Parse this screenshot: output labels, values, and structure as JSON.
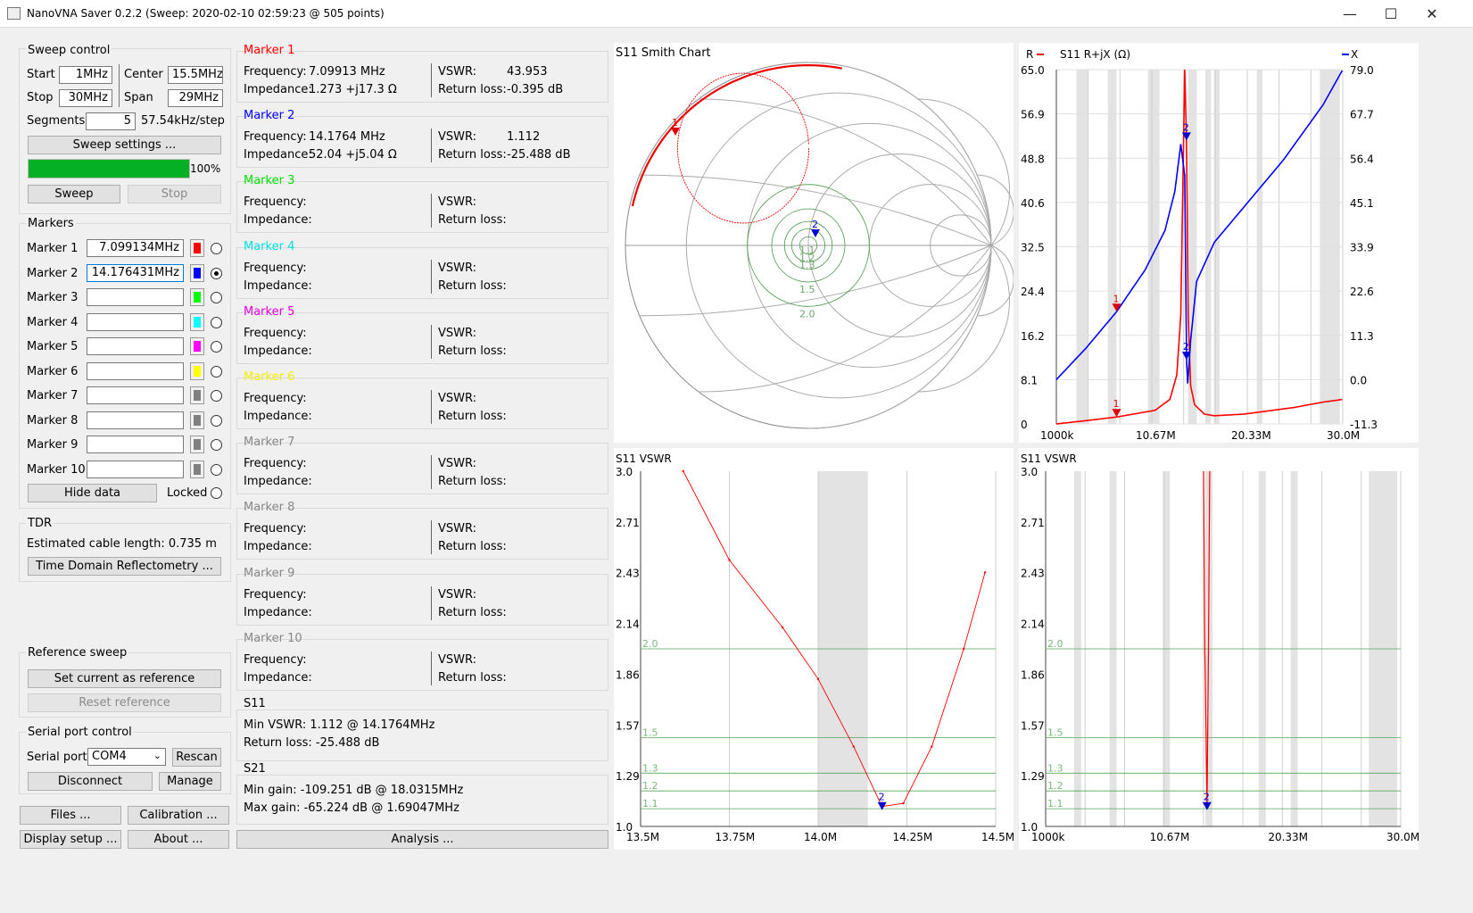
{
  "window": {
    "title": "NanoVNA Saver 0.2.2 (Sweep: 2020-02-10 02:59:23 @ 505 points)"
  },
  "sweep": {
    "title": "Sweep control",
    "start_label": "Start",
    "start": "1MHz",
    "center_label": "Center",
    "center": "15.5MHz",
    "stop_label": "Stop",
    "stop": "30MHz",
    "span_label": "Span",
    "span": "29MHz",
    "segments_label": "Segments",
    "segments": "5",
    "step": "57.54kHz/step",
    "settings_button": "Sweep settings ...",
    "progress": 100,
    "progress_label": "100%",
    "sweep_button": "Sweep",
    "stop_button": "Stop"
  },
  "markers_panel": {
    "title": "Markers",
    "items": [
      {
        "label": "Marker 1",
        "value": "7.099134MHz",
        "color": "#ff0000",
        "selected": false
      },
      {
        "label": "Marker 2",
        "value": "14.176431MHz",
        "color": "#0000ff",
        "selected": true
      },
      {
        "label": "Marker 3",
        "value": "",
        "color": "#00ff00",
        "selected": false
      },
      {
        "label": "Marker 4",
        "value": "",
        "color": "#00ffff",
        "selected": false
      },
      {
        "label": "Marker 5",
        "value": "",
        "color": "#ff00ff",
        "selected": false
      },
      {
        "label": "Marker 6",
        "value": "",
        "color": "#ffff00",
        "selected": false
      },
      {
        "label": "Marker 7",
        "value": "",
        "color": "#808080",
        "selected": false
      },
      {
        "label": "Marker 8",
        "value": "",
        "color": "#808080",
        "selected": false
      },
      {
        "label": "Marker 9",
        "value": "",
        "color": "#808080",
        "selected": false
      },
      {
        "label": "Marker 10",
        "value": "",
        "color": "#808080",
        "selected": false
      }
    ],
    "hide_button": "Hide data",
    "locked_label": "Locked"
  },
  "tdr": {
    "title": "TDR",
    "cable_text": "Estimated cable length: 0.735 m",
    "button": "Time Domain Reflectometry ..."
  },
  "reference": {
    "title": "Reference sweep",
    "set_button": "Set current as reference",
    "reset_button": "Reset reference"
  },
  "serial": {
    "title": "Serial port control",
    "port_label": "Serial port",
    "port_value": "COM4",
    "rescan_button": "Rescan",
    "disconnect_button": "Disconnect",
    "manage_button": "Manage"
  },
  "bottom_buttons": {
    "files": "Files ...",
    "calibration": "Calibration ...",
    "display": "Display setup ...",
    "about": "About ...",
    "analysis": "Analysis ..."
  },
  "marker_details": {
    "freq_label": "Frequency:",
    "imp_label": "Impedance:",
    "vswr_label": "VSWR:",
    "rl_label": "Return loss:",
    "items": [
      {
        "title": "Marker 1",
        "color": "#ff0000",
        "frequency": "7.09913 MHz",
        "impedance": "1.273 +j17.3 Ω",
        "vswr": "43.953",
        "return_loss": "-0.395 dB"
      },
      {
        "title": "Marker 2",
        "color": "#0000ff",
        "frequency": "14.1764 MHz",
        "impedance": "52.04 +j5.04 Ω",
        "vswr": "1.112",
        "return_loss": "-25.488 dB"
      },
      {
        "title": "Marker 3",
        "color": "#00e000",
        "frequency": "",
        "impedance": "",
        "vswr": "",
        "return_loss": ""
      },
      {
        "title": "Marker 4",
        "color": "#00e0e0",
        "frequency": "",
        "impedance": "",
        "vswr": "",
        "return_loss": ""
      },
      {
        "title": "Marker 5",
        "color": "#e000e0",
        "frequency": "",
        "impedance": "",
        "vswr": "",
        "return_loss": ""
      },
      {
        "title": "Marker 6",
        "color": "#f0f000",
        "frequency": "",
        "impedance": "",
        "vswr": "",
        "return_loss": ""
      },
      {
        "title": "Marker 7",
        "color": "#888888",
        "frequency": "",
        "impedance": "",
        "vswr": "",
        "return_loss": ""
      },
      {
        "title": "Marker 8",
        "color": "#888888",
        "frequency": "",
        "impedance": "",
        "vswr": "",
        "return_loss": ""
      },
      {
        "title": "Marker 9",
        "color": "#888888",
        "frequency": "",
        "impedance": "",
        "vswr": "",
        "return_loss": ""
      },
      {
        "title": "Marker 10",
        "color": "#888888",
        "frequency": "",
        "impedance": "",
        "vswr": "",
        "return_loss": ""
      }
    ]
  },
  "s11_summary": {
    "title": "S11",
    "min_vswr": "Min VSWR:  1.112 @ 14.1764MHz",
    "return_loss": "Return loss: -25.488 dB"
  },
  "s21_summary": {
    "title": "S21",
    "min_gain": "Min gain:  -109.251 dB @ 18.0315MHz",
    "max_gain": "Max gain:  -65.224 dB @ 1.69047MHz"
  },
  "chart_data": [
    {
      "type": "smith",
      "title": "S11 Smith Chart",
      "vswr_circles": [
        "1.1",
        "1.2",
        "1.3",
        "1.5",
        "2.0"
      ],
      "markers": [
        "1",
        "2"
      ]
    },
    {
      "type": "line",
      "title": "S11  R+jX (Ω)",
      "legend": [
        "R",
        "X"
      ],
      "x_tick_labels": [
        "1000k",
        "10.67M",
        "20.33M",
        "30.0M"
      ],
      "y_left_ticks": [
        "65.0",
        "56.9",
        "48.8",
        "40.6",
        "32.5",
        "24.4",
        "16.2",
        "8.1",
        "0"
      ],
      "y_right_ticks": [
        "79.0",
        "67.7",
        "56.4",
        "45.1",
        "33.9",
        "22.6",
        "11.3",
        "0.0",
        "-11.3"
      ],
      "ylim_r": [
        0,
        65
      ],
      "ylim_x": [
        -11.3,
        79
      ],
      "series": [
        {
          "name": "R",
          "color": "#ff0000",
          "x_mhz": [
            1,
            4,
            7.1,
            11,
            12.5,
            13.2,
            13.6,
            14.0,
            14.18,
            14.35,
            14.6,
            15.0,
            16,
            17,
            20,
            25,
            28,
            30
          ],
          "values": [
            0,
            0.6,
            1.27,
            2.5,
            4.5,
            9,
            20,
            65,
            52,
            20,
            7,
            3.5,
            1.8,
            1.5,
            1.8,
            3,
            4,
            4.5
          ]
        },
        {
          "name": "X",
          "color": "#0000ff",
          "x_mhz": [
            1,
            4,
            7.1,
            10,
            12,
            13,
            13.6,
            14.0,
            14.18,
            14.3,
            14.6,
            15.2,
            17,
            20,
            24,
            28,
            30
          ],
          "values": [
            0,
            8,
            17.3,
            28,
            38,
            48,
            60,
            52,
            5.04,
            -1,
            10,
            25,
            35,
            44,
            56,
            70,
            79
          ]
        }
      ]
    },
    {
      "type": "line",
      "title": "S11  VSWR",
      "x_tick_labels": [
        "13.5M",
        "13.75M",
        "14.0M",
        "14.25M",
        "14.5M"
      ],
      "y_ticks": [
        "3.0",
        "2.71",
        "2.43",
        "2.14",
        "1.86",
        "1.57",
        "1.29",
        "1.0"
      ],
      "ylim": [
        1.0,
        3.0
      ],
      "xlim_mhz": [
        13.5,
        14.5
      ],
      "series": [
        {
          "name": "VSWR",
          "color": "#ff0000",
          "x_mhz": [
            13.62,
            13.75,
            13.9,
            14.0,
            14.1,
            14.18,
            14.24,
            14.32,
            14.41,
            14.47
          ],
          "values": [
            3.0,
            2.5,
            2.12,
            1.83,
            1.45,
            1.112,
            1.13,
            1.45,
            2.0,
            2.43
          ]
        }
      ]
    },
    {
      "type": "line",
      "title": "S11  VSWR",
      "x_tick_labels": [
        "1000k",
        "10.67M",
        "20.33M",
        "30.0M"
      ],
      "y_ticks": [
        "3.0",
        "2.71",
        "2.43",
        "2.14",
        "1.86",
        "1.57",
        "1.29",
        "1.0"
      ],
      "ylim": [
        1.0,
        3.0
      ],
      "series": [
        {
          "name": "VSWR",
          "color": "#ff0000",
          "x_mhz": [
            13.9,
            14.0,
            14.18,
            14.3,
            14.4
          ],
          "values": [
            3.0,
            2.0,
            1.112,
            2.0,
            3.0
          ]
        }
      ]
    }
  ]
}
